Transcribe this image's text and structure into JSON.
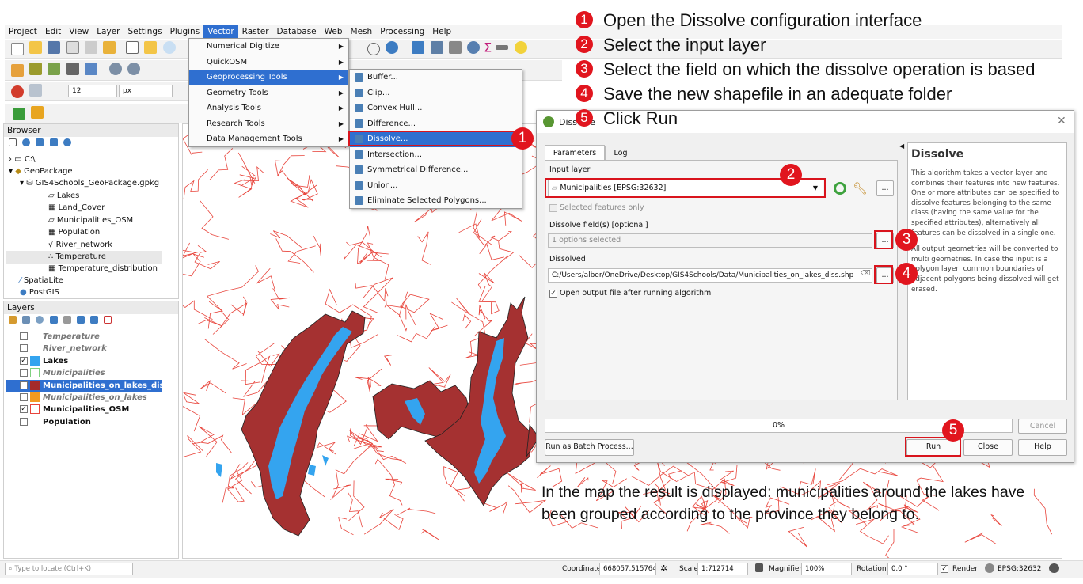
{
  "menubar": [
    "Project",
    "Edit",
    "View",
    "Layer",
    "Settings",
    "Plugins",
    "Vector",
    "Raster",
    "Database",
    "Web",
    "Mesh",
    "Processing",
    "Help"
  ],
  "vector_menu": {
    "items": [
      "Numerical Digitize",
      "QuickOSM",
      "Geoprocessing Tools",
      "Geometry Tools",
      "Analysis Tools",
      "Research Tools",
      "Data Management Tools"
    ],
    "selected": "Geoprocessing Tools"
  },
  "geoprocessing_submenu": {
    "items": [
      "Buffer...",
      "Clip...",
      "Convex Hull...",
      "Difference...",
      "Dissolve...",
      "Intersection...",
      "Symmetrical Difference...",
      "Union...",
      "Eliminate Selected Polygons..."
    ],
    "selected": "Dissolve..."
  },
  "toolbar": {
    "size_value": "12",
    "size_unit": "px"
  },
  "browser": {
    "title": "Browser",
    "items": [
      "C:\\",
      "GeoPackage",
      "GIS4Schools_GeoPackage.gpkg",
      "Lakes",
      "Land_Cover",
      "Municipalities_OSM",
      "Population",
      "River_network",
      "Temperature",
      "Temperature_distribution",
      "SpatiaLite",
      "PostGIS"
    ]
  },
  "layers": {
    "title": "Layers",
    "items": [
      {
        "name": "Temperature",
        "checked": false,
        "style": "italic"
      },
      {
        "name": "River_network",
        "checked": false,
        "style": "italic"
      },
      {
        "name": "Lakes",
        "checked": true,
        "style": "bold",
        "color": "#34a4ef"
      },
      {
        "name": "Municipalities",
        "checked": false,
        "style": "italic",
        "color": "#7fd17f"
      },
      {
        "name": "Municipalities_on_lakes_diss",
        "checked": true,
        "style": "bold",
        "color": "#a52a2a",
        "selected": true
      },
      {
        "name": "Municipalities_on_lakes",
        "checked": false,
        "style": "italic",
        "color": "#f39a21"
      },
      {
        "name": "Municipalities_OSM",
        "checked": true,
        "style": "bold",
        "color": "#ffffff"
      },
      {
        "name": "Population",
        "checked": false,
        "style": "bold"
      }
    ]
  },
  "dialog": {
    "title": "Dissolve",
    "tabs": [
      "Parameters",
      "Log"
    ],
    "input_layer_label": "Input layer",
    "input_layer_value": "Municipalities [EPSG:32632]",
    "selected_only_label": "Selected features only",
    "dissolve_fields_label": "Dissolve field(s) [optional]",
    "dissolve_fields_value": "1 options selected",
    "dissolved_label": "Dissolved",
    "dissolved_value": "C:/Users/alber/OneDrive/Desktop/GIS4Schools/Data/Municipalities_on_lakes_diss.shp",
    "open_output_label": "Open output file after running algorithm",
    "help_title": "Dissolve",
    "help_text_1": "This algorithm takes a vector layer and combines their features into new features. One or more attributes can be specified to dissolve features belonging to the same class (having the same value for the specified attributes), alternatively all features can be dissolved in a single one.",
    "help_text_2": "All output geometries will be converted to multi geometries. In case the input is a polygon layer, common boundaries of adjacent polygons being dissolved will get erased.",
    "progress": "0%",
    "cancel": "Cancel",
    "batch": "Run as Batch Process...",
    "run": "Run",
    "close": "Close",
    "help": "Help",
    "ellipsis": "..."
  },
  "annotations": [
    {
      "n": "1",
      "text": "Open the Dissolve configuration interface"
    },
    {
      "n": "2",
      "text": "Select the input layer"
    },
    {
      "n": "3",
      "text": "Select the field on which the dissolve operation is based"
    },
    {
      "n": "4",
      "text": "Save the new shapefile in an adequate folder"
    },
    {
      "n": "5",
      "text": "Click Run"
    }
  ],
  "result_note": "In the map the result is displayed: municipalities around the lakes have been grouped according to the province they belong to.",
  "statusbar": {
    "locate_placeholder": "Type to locate (Ctrl+K)",
    "coordinate_label": "Coordinate",
    "coordinate": "668057,5157641",
    "scale_label": "Scale",
    "scale": "1:712714",
    "magnifier_label": "Magnifier",
    "magnifier": "100%",
    "rotation_label": "Rotation",
    "rotation": "0,0 °",
    "render_label": "Render",
    "crs": "EPSG:32632"
  },
  "colors": {
    "accent": "#2f6fd0",
    "badge": "#e1151e",
    "lake": "#34a4ef",
    "dissolved": "#a52a2a",
    "boundary": "#e8453c"
  }
}
